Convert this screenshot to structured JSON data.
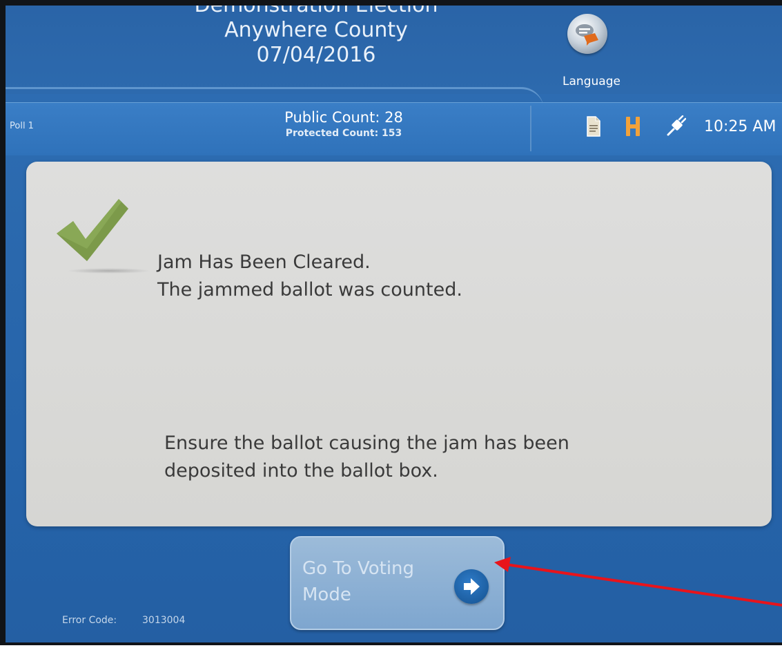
{
  "header": {
    "election_lines": [
      "Demonstration Election",
      "Anywhere County",
      "07/04/2016"
    ],
    "language_label": "Language"
  },
  "status_bar": {
    "poll": "Poll 1",
    "public_count": "Public Count: 28",
    "protected_count": "Protected Count: 153",
    "icons": [
      "document-icon",
      "h-icon",
      "power-plug-icon"
    ],
    "time": "10:25 AM"
  },
  "message": {
    "title": "Jam Has Been Cleared.",
    "subtitle": "The jammed ballot was counted.",
    "instruction": "Ensure the ballot causing the jam has been deposited into the ballot box.",
    "icon": "checkmark-icon"
  },
  "actions": {
    "go_to_voting_mode": "Go To Voting Mode"
  },
  "footer": {
    "error_label": "Error Code:",
    "error_code": "3013004"
  },
  "colors": {
    "screen_blue": "#2f6fb4",
    "panel_bg": "#dededd",
    "check_green": "#7c9a4a",
    "h_icon_orange": "#f2a23a",
    "annotation_red": "#e8141b"
  }
}
